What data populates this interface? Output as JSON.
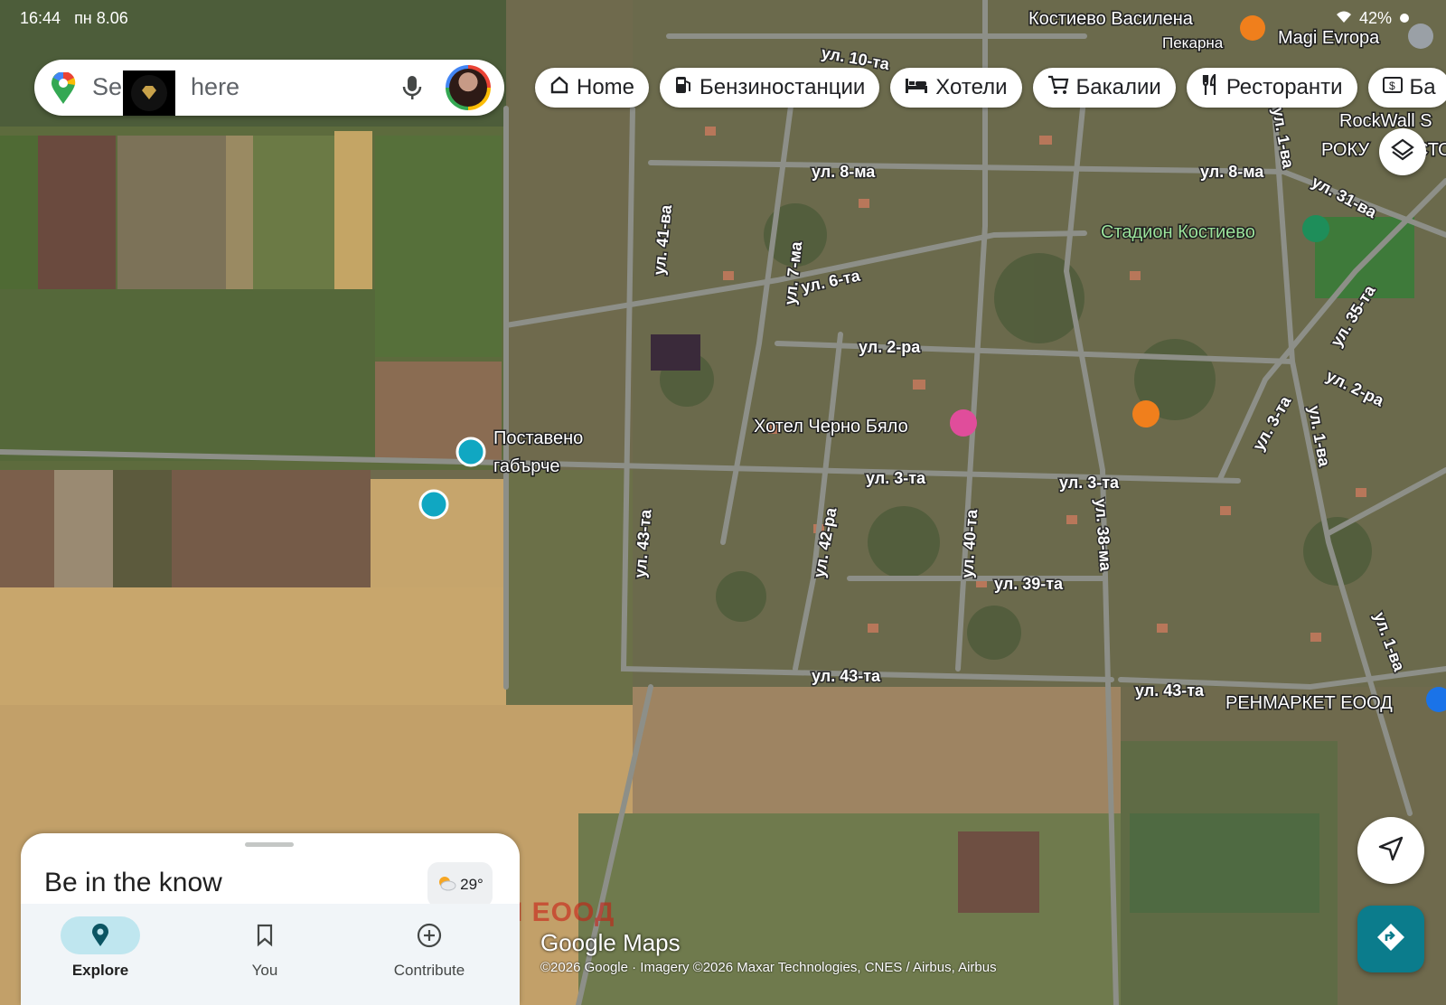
{
  "status_bar": {
    "time": "16:44",
    "date": "пн 8.06",
    "battery": "42%"
  },
  "search": {
    "placeholder_visible_start": "Se",
    "placeholder_visible_end": "here"
  },
  "chips": [
    {
      "label": "Home",
      "icon": "home-icon"
    },
    {
      "label": "Бензиностанции",
      "icon": "gas-station-icon"
    },
    {
      "label": "Хотели",
      "icon": "bed-icon"
    },
    {
      "label": "Бакалии",
      "icon": "cart-icon"
    },
    {
      "label": "Ресторанти",
      "icon": "restaurant-icon"
    },
    {
      "label": "Ба",
      "icon": "bank-icon"
    }
  ],
  "map": {
    "places": {
      "bakery": "Костиево Василена",
      "bakery_sub": "Пекарна",
      "shop": "Magi Evropa",
      "rockwall": "RockWall S",
      "roku": "РОКУ",
      "roku2": "СТО",
      "stadium": "Стадион Костиево",
      "hotel": "Хотел Черно Бяло",
      "saved1": "Поставено",
      "saved1b": "габърче",
      "renmarket": "РЕНМАРКЕТ ЕООД"
    },
    "streets": {
      "s10": "ул. 10-та",
      "s8a": "ул. 8-ма",
      "s8b": "ул. 8-ма",
      "s31": "ул. 31-ва",
      "s1a": "ул. 1-ва",
      "s41": "ул. 41-ва",
      "s7": "ул. 7-ма",
      "s6": "ул. 6-та",
      "s2": "ул. 2-ра",
      "s35": "ул. 35-та",
      "s2b": "ул. 2-ра",
      "s3b": "ул. 3-та",
      "s1b": "ул. 1-ва",
      "s3a": "ул. 3-та",
      "s3c": "ул. 3-та",
      "s43a": "ул. 43-та",
      "s42": "ул. 42-ра",
      "s40": "ул. 40-та",
      "s38": "ул. 38-ма",
      "s39": "ул. 39-та",
      "s43b": "ул. 43-та",
      "s43c": "ул. 43-та",
      "s1c": "ул. 1-ва"
    }
  },
  "sheet": {
    "title": "Be in the know",
    "temperature": "29°"
  },
  "bottom_nav": [
    {
      "label": "Explore",
      "icon": "explore-pin-icon",
      "active": true
    },
    {
      "label": "You",
      "icon": "bookmark-icon",
      "active": false
    },
    {
      "label": "Contribute",
      "icon": "add-circle-icon",
      "active": false
    }
  ],
  "watermark": "ДАЙМЪНД ХОУМ БЪЛГАРИЯ ЕООД",
  "branding": "Google Maps",
  "credits": "©2026 Google · Imagery ©2026 Maxar Technologies, CNES / Airbus, Airbus"
}
